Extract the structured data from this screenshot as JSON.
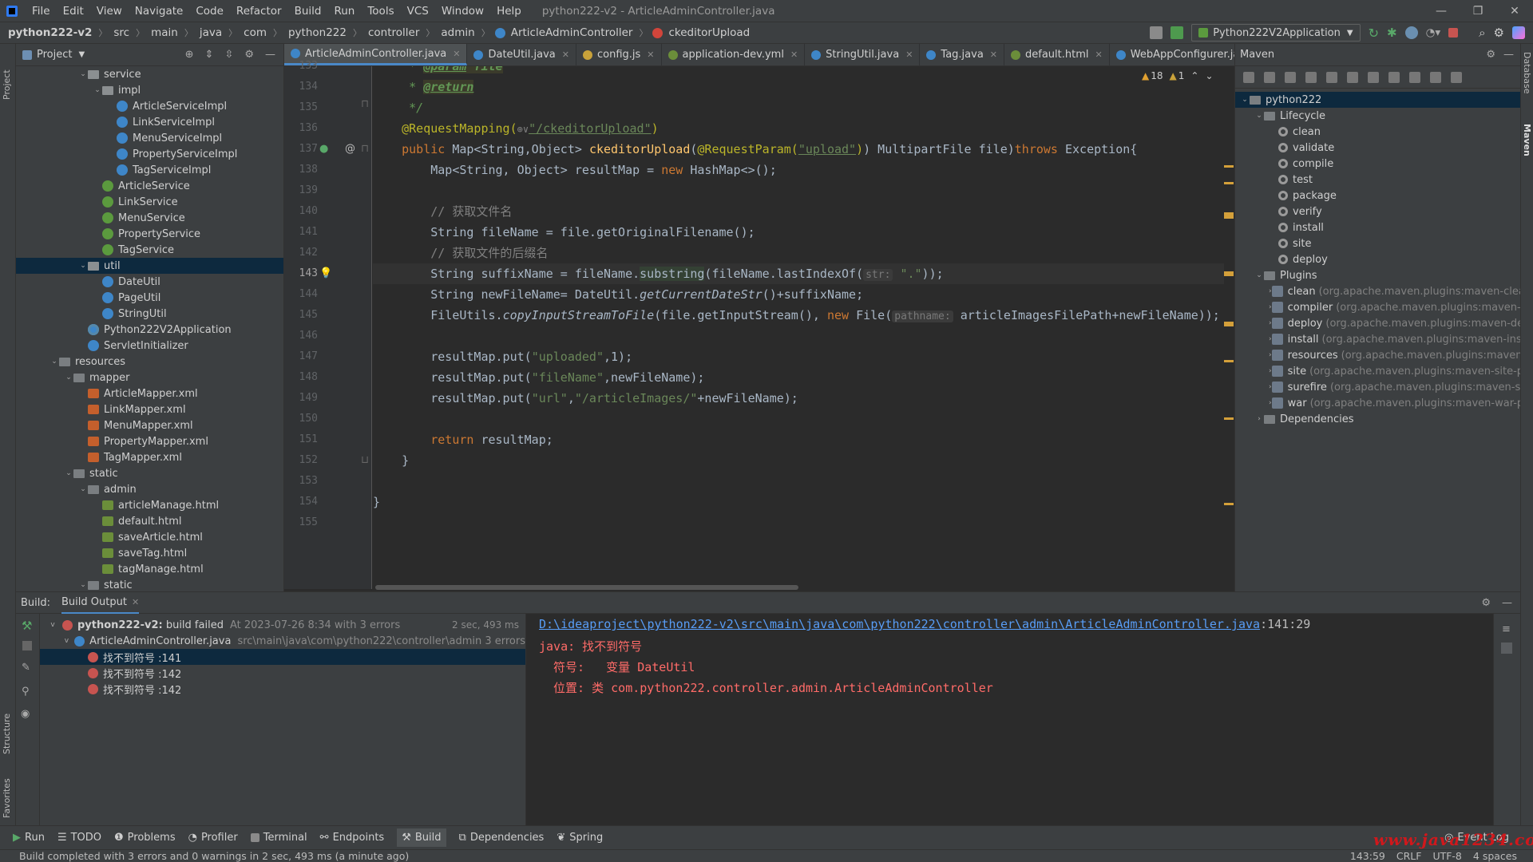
{
  "menu": {
    "items": [
      "File",
      "Edit",
      "View",
      "Navigate",
      "Code",
      "Refactor",
      "Build",
      "Run",
      "Tools",
      "VCS",
      "Window",
      "Help"
    ],
    "window_title": "python222-v2 - ArticleAdminController.java"
  },
  "breadcrumb": [
    "python222-v2",
    "src",
    "main",
    "java",
    "com",
    "python222",
    "controller",
    "admin",
    "ArticleAdminController",
    "ckeditorUpload"
  ],
  "run_config": "Python222V2Application",
  "project": {
    "title": "Project",
    "tree": [
      {
        "label": "service",
        "type": "pkg",
        "depth": 5,
        "arrow": "v"
      },
      {
        "label": "impl",
        "type": "pkg",
        "depth": 6,
        "arrow": "v"
      },
      {
        "label": "ArticleServiceImpl",
        "type": "cls",
        "depth": 7
      },
      {
        "label": "LinkServiceImpl",
        "type": "cls",
        "depth": 7
      },
      {
        "label": "MenuServiceImpl",
        "type": "cls",
        "depth": 7
      },
      {
        "label": "PropertyServiceImpl",
        "type": "cls",
        "depth": 7
      },
      {
        "label": "TagServiceImpl",
        "type": "cls",
        "depth": 7
      },
      {
        "label": "ArticleService",
        "type": "intf",
        "depth": 6
      },
      {
        "label": "LinkService",
        "type": "intf",
        "depth": 6
      },
      {
        "label": "MenuService",
        "type": "intf",
        "depth": 6
      },
      {
        "label": "PropertyService",
        "type": "intf",
        "depth": 6
      },
      {
        "label": "TagService",
        "type": "intf",
        "depth": 6
      },
      {
        "label": "util",
        "type": "pkg",
        "depth": 5,
        "arrow": "v",
        "selected": true
      },
      {
        "label": "DateUtil",
        "type": "cls",
        "depth": 6
      },
      {
        "label": "PageUtil",
        "type": "cls",
        "depth": 6
      },
      {
        "label": "StringUtil",
        "type": "cls",
        "depth": 6
      },
      {
        "label": "Python222V2Application",
        "type": "app",
        "depth": 5
      },
      {
        "label": "ServletInitializer",
        "type": "cls",
        "depth": 5
      },
      {
        "label": "resources",
        "type": "folder",
        "depth": 3,
        "arrow": "v"
      },
      {
        "label": "mapper",
        "type": "folder",
        "depth": 4,
        "arrow": "v"
      },
      {
        "label": "ArticleMapper.xml",
        "type": "xml",
        "depth": 5
      },
      {
        "label": "LinkMapper.xml",
        "type": "xml",
        "depth": 5
      },
      {
        "label": "MenuMapper.xml",
        "type": "xml",
        "depth": 5
      },
      {
        "label": "PropertyMapper.xml",
        "type": "xml",
        "depth": 5
      },
      {
        "label": "TagMapper.xml",
        "type": "xml",
        "depth": 5
      },
      {
        "label": "static",
        "type": "folder",
        "depth": 4,
        "arrow": "v"
      },
      {
        "label": "admin",
        "type": "folder",
        "depth": 5,
        "arrow": "v"
      },
      {
        "label": "articleManage.html",
        "type": "html",
        "depth": 6
      },
      {
        "label": "default.html",
        "type": "html",
        "depth": 6
      },
      {
        "label": "saveArticle.html",
        "type": "html",
        "depth": 6
      },
      {
        "label": "saveTag.html",
        "type": "html",
        "depth": 6
      },
      {
        "label": "tagManage.html",
        "type": "html",
        "depth": 6
      },
      {
        "label": "static",
        "type": "folder",
        "depth": 5,
        "arrow": "v"
      }
    ]
  },
  "tabs": [
    {
      "label": "ArticleAdminController.java",
      "active": true,
      "color": "#3e86c8"
    },
    {
      "label": "DateUtil.java",
      "color": "#3e86c8"
    },
    {
      "label": "config.js",
      "color": "#c9a23a"
    },
    {
      "label": "application-dev.yml",
      "color": "#6b8e3a"
    },
    {
      "label": "StringUtil.java",
      "color": "#3e86c8"
    },
    {
      "label": "Tag.java",
      "color": "#3e86c8"
    },
    {
      "label": "default.html",
      "color": "#6b8e3a"
    },
    {
      "label": "WebAppConfigurer.java",
      "color": "#3e86c8"
    }
  ],
  "editor": {
    "line_numbers": [
      "133",
      "134",
      "135",
      "136",
      "137",
      "138",
      "139",
      "140",
      "141",
      "142",
      "143",
      "144",
      "145",
      "146",
      "147",
      "148",
      "149",
      "150",
      "151",
      "152",
      "153",
      "154",
      "155"
    ],
    "inspection_warnings": "18",
    "inspection_weak": "1",
    "code": {
      "l133_star": "     * ",
      "l133_tag": "@param",
      "l133_name": " file",
      "l134_star": "     * ",
      "l134_tag": "@return",
      "l135": "     */",
      "l136_an": "    @RequestMapping(",
      "l136_icon": "⊕∨",
      "l136_str": "\"/ckeditorUpload\"",
      "l136_end": ")",
      "l137_kw": "    public ",
      "l137_t": "Map<String,Object> ",
      "l137_fn": "ckeditorUpload",
      "l137_p1": "(",
      "l137_an": "@RequestParam(",
      "l137_str": "\"upload\"",
      "l137_p2": ") MultipartFile file)",
      "l137_kw2": "throws ",
      "l137_end": "Exception{",
      "l138_a": "        Map<String, Object> resultMap = ",
      "l138_kw": "new ",
      "l138_b": "HashMap<>();",
      "l140": "        // 获取文件名",
      "l141": "        String fileName = file.getOriginalFilename();",
      "l142": "        // 获取文件的后缀名",
      "l143_a": "        String suffixName = fileName.",
      "l143_hl": "substring",
      "l143_b": "(fileName.lastIndexOf(",
      "l143_hint": "str:",
      "l143_str": " \".\"",
      "l143_c": "));",
      "l144_a": "        String newFileName= DateUtil.",
      "l144_it": "getCurrentDateStr",
      "l144_b": "()+suffixName;",
      "l145_a": "        FileUtils.",
      "l145_it": "copyInputStreamToFile",
      "l145_b": "(file.getInputStream(), ",
      "l145_kw": "new ",
      "l145_c": "File(",
      "l145_hint": "pathname:",
      "l145_d": " articleImagesFilePath+newFileName));",
      "l147_a": "        resultMap.put(",
      "l147_str": "\"uploaded\"",
      "l147_b": ",1);",
      "l148_a": "        resultMap.put(",
      "l148_str": "\"fileName\"",
      "l148_b": ",newFileName);",
      "l149_a": "        resultMap.put(",
      "l149_str": "\"url\"",
      "l149_b": ",",
      "l149_str2": "\"/articleImages/\"",
      "l149_c": "+newFileName);",
      "l151_kw": "        return ",
      "l151_b": "resultMap;",
      "l152": "    }",
      "l154": "}"
    }
  },
  "maven": {
    "title": "Maven",
    "project": "python222",
    "lifecycle_label": "Lifecycle",
    "lifecycle": [
      "clean",
      "validate",
      "compile",
      "test",
      "package",
      "verify",
      "install",
      "site",
      "deploy"
    ],
    "plugins_label": "Plugins",
    "plugins": [
      {
        "name": "clean",
        "detail": "(org.apache.maven.plugins:maven-clean-p"
      },
      {
        "name": "compiler",
        "detail": "(org.apache.maven.plugins:maven-com"
      },
      {
        "name": "deploy",
        "detail": "(org.apache.maven.plugins:maven-depl"
      },
      {
        "name": "install",
        "detail": "(org.apache.maven.plugins:maven-install"
      },
      {
        "name": "resources",
        "detail": "(org.apache.maven.plugins:maven-re"
      },
      {
        "name": "site",
        "detail": "(org.apache.maven.plugins:maven-site-plug"
      },
      {
        "name": "surefire",
        "detail": "(org.apache.maven.plugins:maven-sure"
      },
      {
        "name": "war",
        "detail": "(org.apache.maven.plugins:maven-war-plu"
      }
    ],
    "dependencies_label": "Dependencies"
  },
  "build": {
    "label": "Build:",
    "tab": "Build Output",
    "root": "python222-v2:",
    "root_status": "build failed",
    "root_when": "At 2023-07-26 8:34 with 3 errors",
    "root_time": "2 sec, 493 ms",
    "file": "ArticleAdminController.java",
    "file_path": "src\\main\\java\\com\\python222\\controller\\admin 3 errors",
    "errors": [
      "找不到符号 :141",
      "找不到符号 :142",
      "找不到符号 :142"
    ],
    "output_link": "D:\\ideaproject\\python222-v2\\src\\main\\java\\com\\python222\\controller\\admin\\ArticleAdminController.java",
    "output_pos": ":141:29",
    "output_lines": [
      "java: 找不到符号",
      "  符号:   变量 DateUtil",
      "  位置: 类 com.python222.controller.admin.ArticleAdminController"
    ]
  },
  "toolwindows": [
    "Run",
    "TODO",
    "Problems",
    "Profiler",
    "Terminal",
    "Endpoints",
    "Build",
    "Dependencies",
    "Spring"
  ],
  "event_log": "Event Log",
  "status": {
    "message": "Build completed with 3 errors and 0 warnings in 2 sec, 493 ms (a minute ago)",
    "position": "143:59",
    "line_sep": "CRLF",
    "encoding": "UTF-8",
    "indent": "4 spaces"
  },
  "side_labels": {
    "project": "Project",
    "structure": "Structure",
    "favorites": "Favorites",
    "database": "Database",
    "maven": "Maven"
  },
  "watermark": "www.java1234.com"
}
